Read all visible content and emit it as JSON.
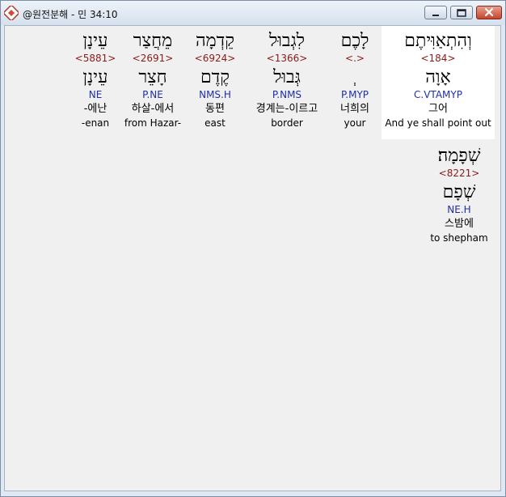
{
  "window": {
    "title": "@원전분해 - 민 34:10",
    "minimize_icon": "minimize-icon",
    "maximize_icon": "maximize-icon",
    "close_icon": "close-icon",
    "app_icon": "bible-app-icon"
  },
  "words": [
    {
      "hebrew": "וְהִתְאַוִּיתֶם",
      "strongs": "<184>",
      "root": "אָוָה",
      "grammar": "C.VTAMYP",
      "korean": "그어",
      "english": "And ye shall point out",
      "selected": true
    },
    {
      "hebrew": "לָכֶם",
      "strongs": "<.>",
      "root": "ְ",
      "grammar": "P.MYP",
      "korean": "너희의",
      "english": "your",
      "selected": false
    },
    {
      "hebrew": "לִגְבוּל",
      "strongs": "<1366>",
      "root": "גְּבוּל",
      "grammar": "P.NMS",
      "korean": "경계는-이르고",
      "english": "border",
      "selected": false
    },
    {
      "hebrew": "קֵדְמָה",
      "strongs": "<6924>",
      "root": "קֶדֶם",
      "grammar": "NMS.H",
      "korean": "동편",
      "english": "east",
      "selected": false
    },
    {
      "hebrew": "מֵחֲצַר",
      "strongs": "<2691>",
      "root": "חָצֵר",
      "grammar": "P.NE",
      "korean": "하살-에서",
      "english": "from Hazar-",
      "selected": false
    },
    {
      "hebrew": "עֵינָן",
      "strongs": "<5881>",
      "root": "עֵינָן",
      "grammar": "NE",
      "korean": "-에난",
      "english": "-enan",
      "selected": false
    },
    {
      "hebrew": "שְׁפָמָה׃",
      "strongs": "<8221>",
      "root": "שְׁפָם",
      "grammar": "NE.H",
      "korean": "스밤에",
      "english": "to shepham",
      "selected": false
    }
  ]
}
